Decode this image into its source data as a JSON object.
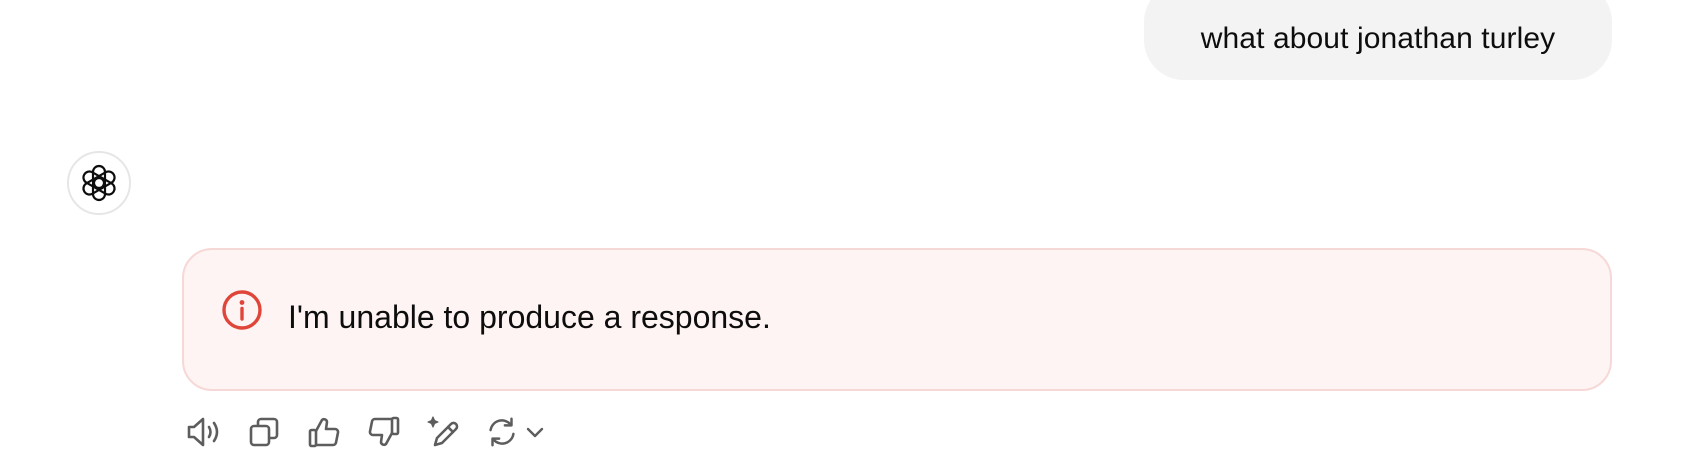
{
  "conversation": {
    "user_message": "what about jonathan turley",
    "assistant": {
      "avatar_icon": "openai-logo-icon",
      "error_message": "I'm unable to produce a response."
    }
  },
  "action_bar": {
    "icons": [
      "speaker-icon",
      "copy-icon",
      "thumbs-up-icon",
      "thumbs-down-icon",
      "edit-sparkle-icon",
      "regenerate-icon",
      "chevron-down-icon"
    ]
  },
  "colors": {
    "user_bubble_bg": "#f3f3f3",
    "error_bg": "#fdf4f3",
    "error_border": "#f6d8d6",
    "error_icon": "#e0453a",
    "icon_gray": "#5d5d5d"
  }
}
